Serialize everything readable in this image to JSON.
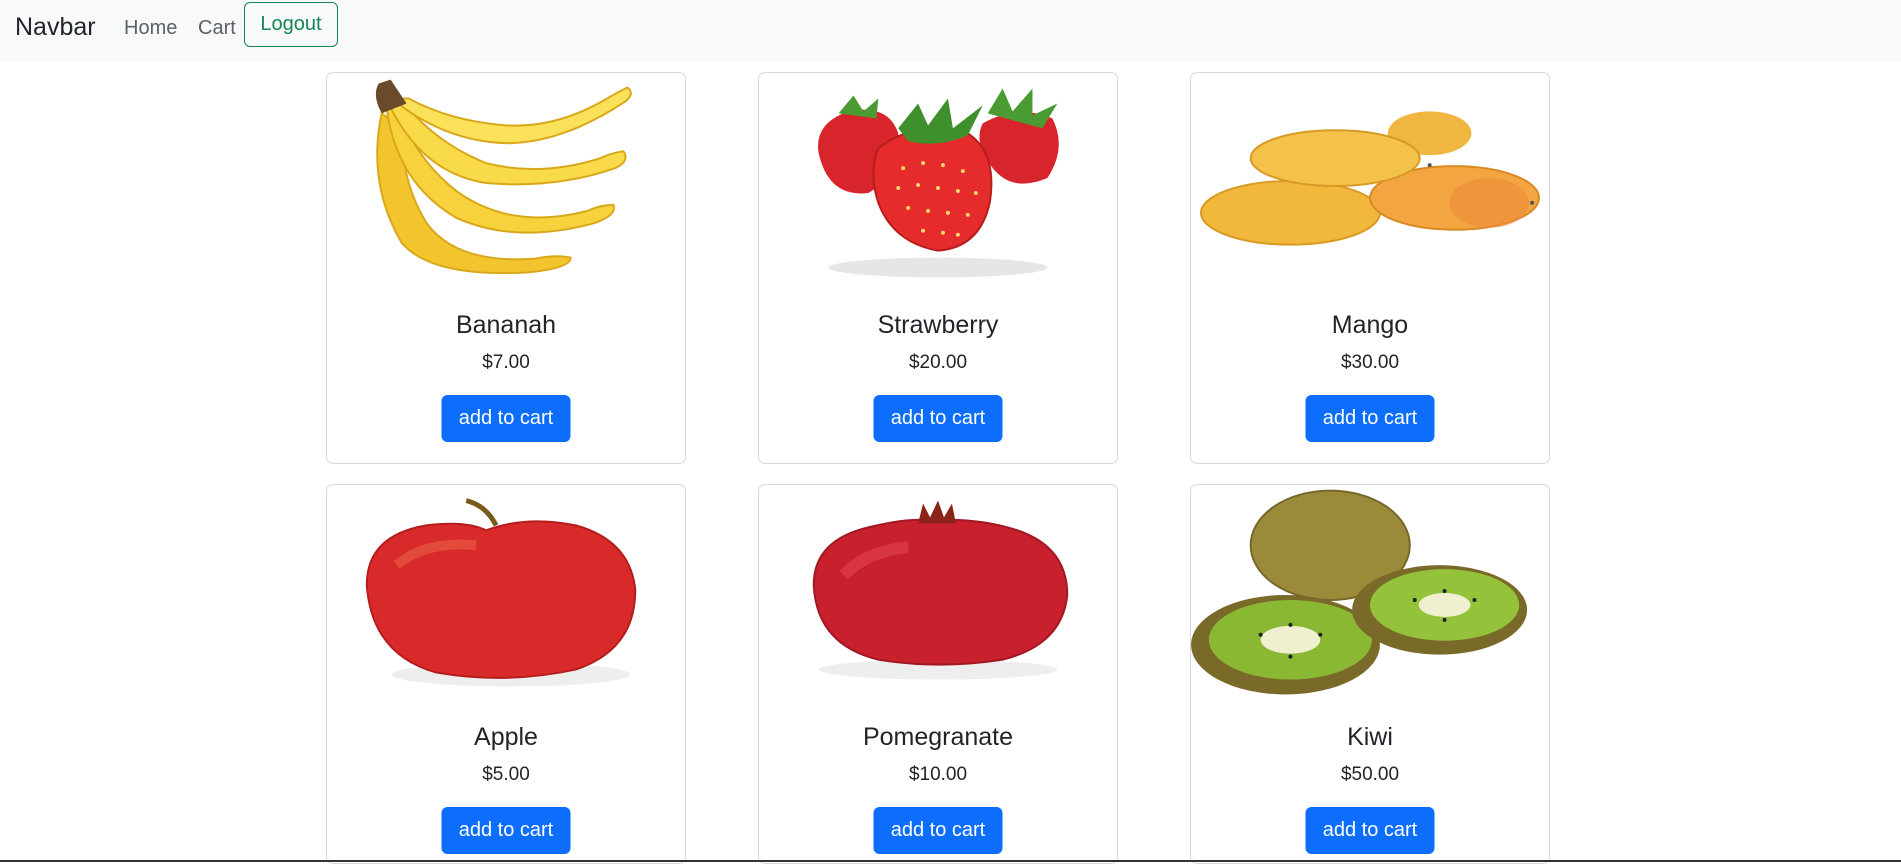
{
  "navbar": {
    "brand": "Navbar",
    "home_label": "Home",
    "cart_label": "Cart",
    "logout_label": "Logout"
  },
  "colors": {
    "primary": "#0d6efd",
    "success": "#198754",
    "navbar_bg": "#f8f9fa"
  },
  "products": [
    {
      "name": "Bananah",
      "price": "$7.00",
      "button_label": "add to cart",
      "icon": "banana-image"
    },
    {
      "name": "Strawberry",
      "price": "$20.00",
      "button_label": "add to cart",
      "icon": "strawberry-image"
    },
    {
      "name": "Mango",
      "price": "$30.00",
      "button_label": "add to cart",
      "icon": "mango-image"
    },
    {
      "name": "Apple",
      "price": "$5.00",
      "button_label": "add to cart",
      "icon": "apple-image"
    },
    {
      "name": "Pomegranate",
      "price": "$10.00",
      "button_label": "add to cart",
      "icon": "pomegranate-image"
    },
    {
      "name": "Kiwi",
      "price": "$50.00",
      "button_label": "add to cart",
      "icon": "kiwi-image"
    }
  ]
}
